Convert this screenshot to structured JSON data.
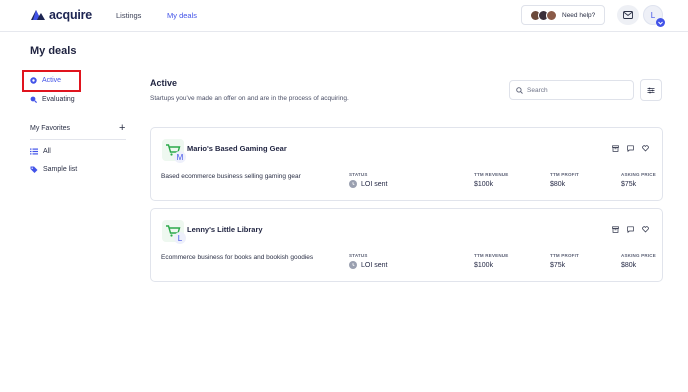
{
  "brand": {
    "name": "acquire",
    "color": "#1d2552",
    "accent": "#4253e8"
  },
  "nav": {
    "links": [
      {
        "label": "Listings",
        "active": false
      },
      {
        "label": "My deals",
        "active": true
      }
    ],
    "help_label": "Need help?",
    "avatar_initial": "L"
  },
  "page": {
    "title": "My deals"
  },
  "sidebar": {
    "items": [
      {
        "label": "Active",
        "icon": "circle-dot-icon",
        "active": true
      },
      {
        "label": "Evaluating",
        "icon": "magnifier-icon",
        "active": false
      }
    ],
    "favorites_title": "My Favorites",
    "favorites_add": "+",
    "favorites": [
      {
        "label": "All",
        "icon": "list-icon"
      },
      {
        "label": "Sample list",
        "icon": "tag-icon"
      }
    ]
  },
  "main": {
    "section_title": "Active",
    "section_subtitle": "Startups you've made an offer on and are in the process of acquiring.",
    "search_placeholder": "Search",
    "columns": {
      "status": "STATUS",
      "ttm_revenue": "TTM REVENUE",
      "ttm_profit": "TTM PROFIT",
      "asking_price": "ASKING PRICE"
    },
    "deals": [
      {
        "name": "Mario's Based Gaming Gear",
        "letter": "M",
        "description": "Based ecommerce business selling gaming gear",
        "status": "LOI sent",
        "ttm_revenue": "$100k",
        "ttm_profit": "$80k",
        "asking_price": "$75k"
      },
      {
        "name": "Lenny's Little Library",
        "letter": "L",
        "description": "Ecommerce business for books and bookish goodies",
        "status": "LOI sent",
        "ttm_revenue": "$100k",
        "ttm_profit": "$75k",
        "asking_price": "$80k"
      }
    ]
  },
  "colors": {
    "highlight_box": "#e0141e",
    "cart_green": "#2ba94a"
  }
}
